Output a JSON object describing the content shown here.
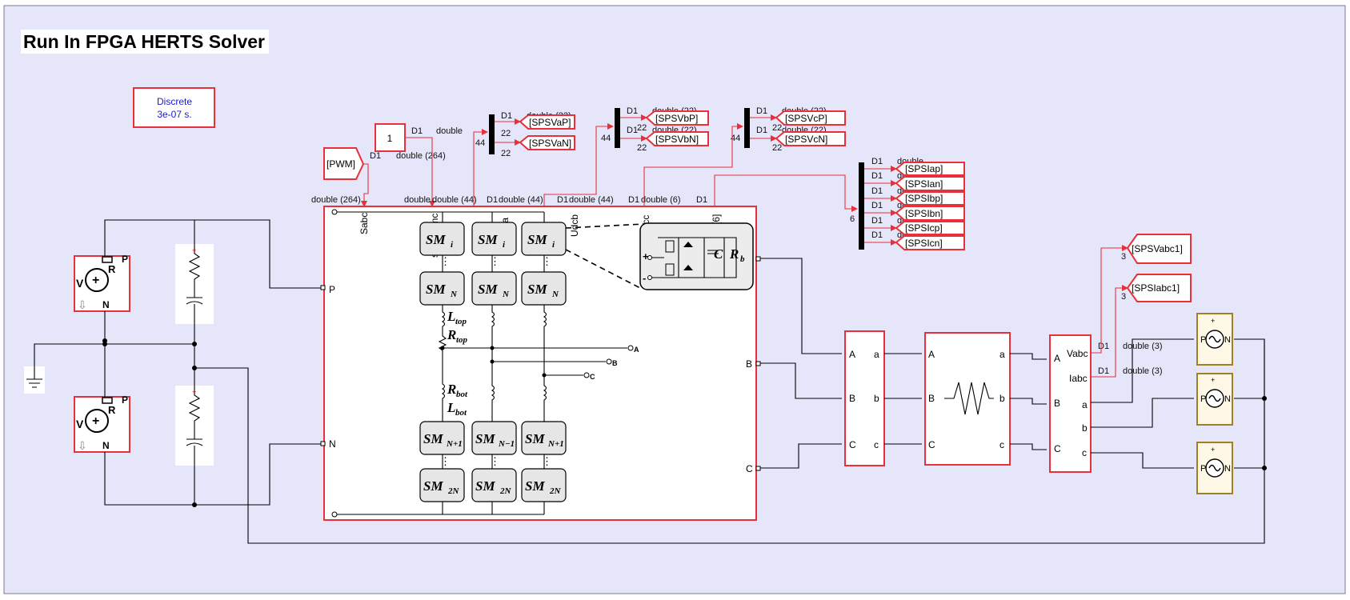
{
  "title": "Run In FPGA HERTS Solver",
  "powergui": {
    "line1": "Discrete",
    "line2": "3e-07 s."
  },
  "constant": "1",
  "pwm_from": "[PWM]",
  "mmc": {
    "in_ports": [
      "Sabc",
      "swEnmmc",
      "Udca",
      "Udcb",
      "Udcc",
      "Iarm[6]"
    ],
    "side_ports": {
      "P": "P",
      "N": "N"
    },
    "out_ports": [
      "A",
      "B",
      "C"
    ],
    "sm": {
      "i": "i",
      "N": "N",
      "Np1": "N+1",
      "Nm1": "N−1",
      "twoN": "2N"
    },
    "l_top": "L",
    "l_top_sub": "top",
    "r_top": "R",
    "r_top_sub": "top",
    "r_bot": "R",
    "r_bot_sub": "bot",
    "l_bot": "L",
    "l_bot_sub": "bot",
    "cell_c": "C",
    "cell_r": "R",
    "cell_r_sub": "b",
    "node_labels": [
      "A",
      "B",
      "C"
    ]
  },
  "signals": {
    "d1": "D1",
    "double": "double",
    "double_264": "double (264)",
    "double_44": "double (44)",
    "double_6": "double (6)",
    "double_22": "double (22)",
    "double_3": "double (3)",
    "n22": "22",
    "n44": "44",
    "n6": "6",
    "n3": "3",
    "top_sig_labels": [
      "double (264)",
      "double",
      "double (44)",
      "D1",
      "double (44)",
      "D1",
      "double (44)",
      "D1",
      "double (6)",
      "D1"
    ]
  },
  "goto_tags": {
    "va": [
      "[SPSVaP]",
      "[SPSVaN]"
    ],
    "vb": [
      "[SPSVbP]",
      "[SPSVbN]"
    ],
    "vc": [
      "[SPSVcP]",
      "[SPSVcN]"
    ],
    "iarm": [
      "[SPSIap]",
      "[SPSIan]",
      "[SPSIbp]",
      "[SPSIbn]",
      "[SPSIcp]",
      "[SPSIcn]"
    ],
    "vabc": "[SPSVabc1]",
    "iabc": "[SPSIabc1]"
  },
  "dc_source": {
    "v": "V",
    "r": "R",
    "p": "P",
    "n": "N"
  },
  "breaker_ports": {
    "in": [
      "A",
      "B",
      "C"
    ],
    "out": [
      "a",
      "b",
      "c"
    ]
  },
  "load_ports": {
    "in": [
      "A",
      "B",
      "C"
    ],
    "out": [
      "a",
      "b",
      "c"
    ]
  },
  "meas": {
    "vabc": "Vabc",
    "iabc": "Iabc",
    "in": [
      "A",
      "B",
      "C"
    ],
    "out": [
      "a",
      "b",
      "c"
    ]
  },
  "ac_source": {
    "p": "P",
    "n": "N"
  }
}
